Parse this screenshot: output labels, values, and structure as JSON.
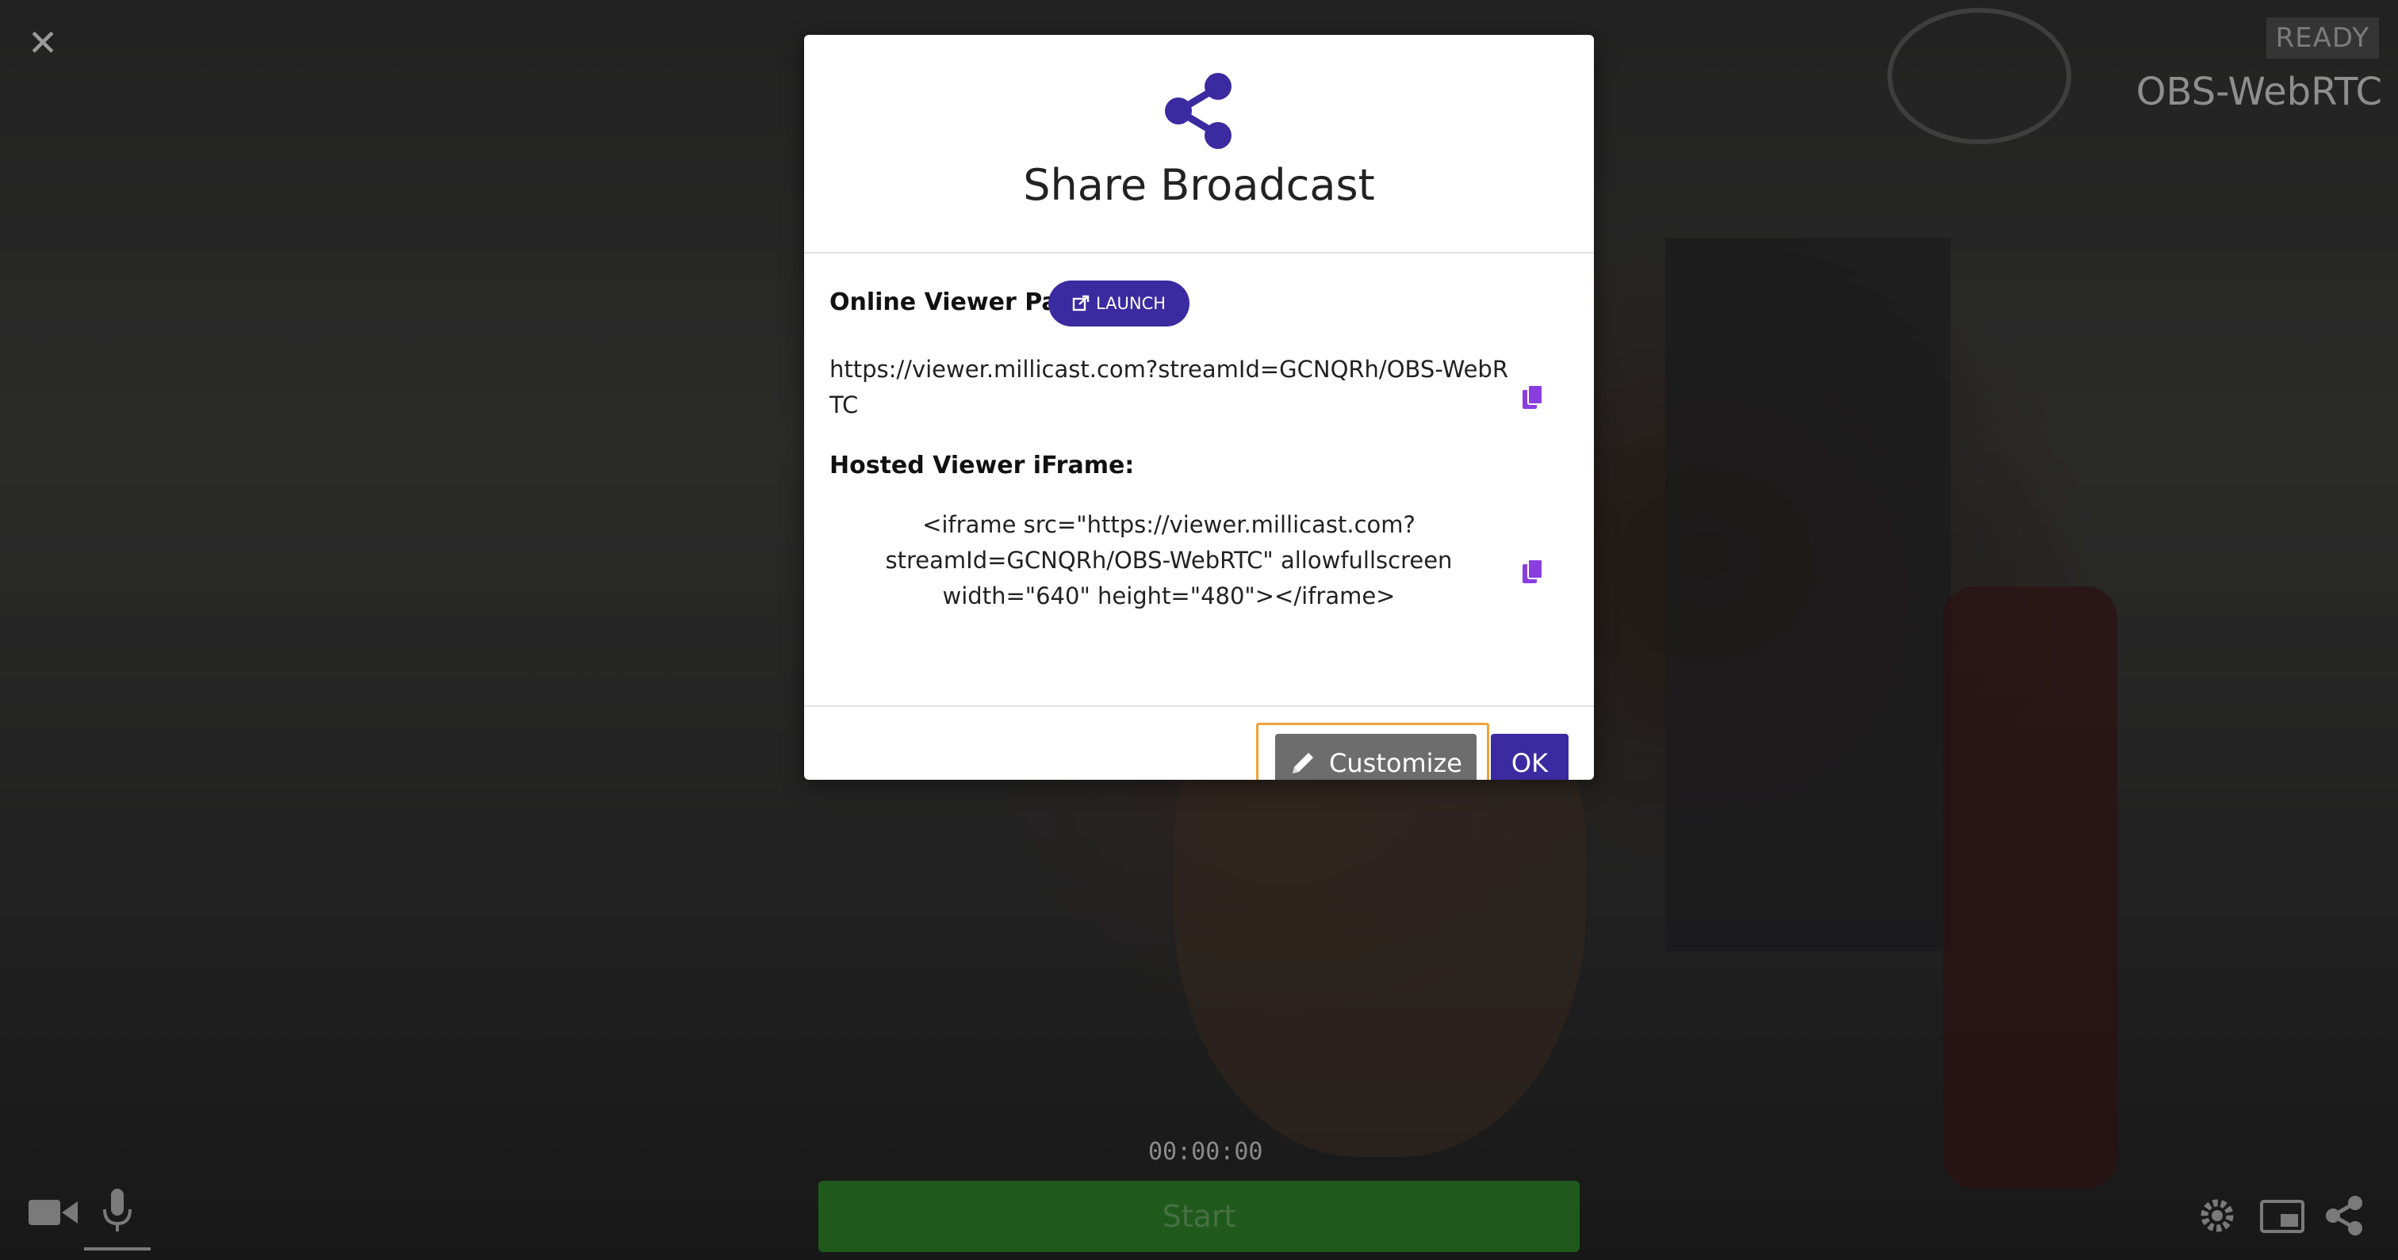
{
  "background": {
    "ready_label": "READY",
    "stream_name": "OBS-WebRTC",
    "timer": "00:00:00",
    "start_label": "Start"
  },
  "modal": {
    "title": "Share Broadcast",
    "online_viewer_label": "Online Viewer Path:",
    "launch_label": "LAUNCH",
    "viewer_url": "https://viewer.millicast.com?streamId=GCNQRh/OBS-WebRTC",
    "iframe_label": "Hosted Viewer iFrame:",
    "iframe_code": "<iframe src=\"https://viewer.millicast.com?streamId=GCNQRh/OBS-WebRTC\" allowfullscreen width=\"640\" height=\"480\"></iframe>",
    "customize_label": "Customize",
    "ok_label": "OK"
  },
  "colors": {
    "accent": "#3b2aa0",
    "copy_icon": "#8a3ee0",
    "highlight": "#f0a23a",
    "start_green": "#1f5a1c"
  }
}
